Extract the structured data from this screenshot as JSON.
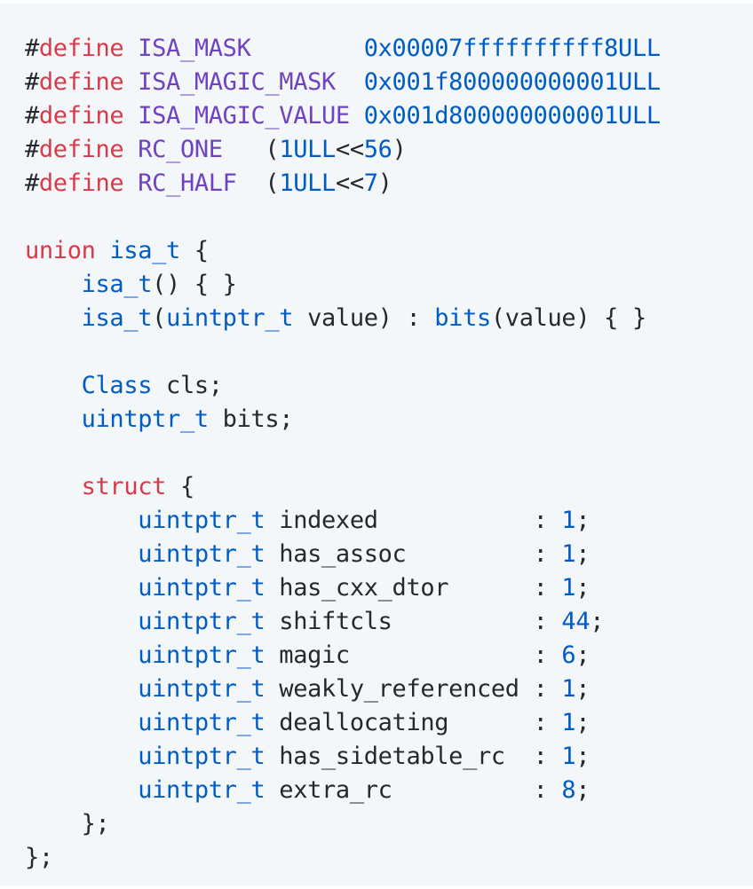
{
  "colors": {
    "background": "#f4f7fa",
    "plain": "#24292e",
    "keyword": "#d73a49",
    "macro": "#6f42c1",
    "type": "#005cc5",
    "number": "#005cc5"
  },
  "code_lines": [
    [
      [
        "plain",
        "#"
      ],
      [
        "keyword",
        "define"
      ],
      [
        "plain",
        " "
      ],
      [
        "macro",
        "ISA_MASK"
      ],
      [
        "plain",
        "        "
      ],
      [
        "number",
        "0x00007ffffffffff8ULL"
      ]
    ],
    [
      [
        "plain",
        "#"
      ],
      [
        "keyword",
        "define"
      ],
      [
        "plain",
        " "
      ],
      [
        "macro",
        "ISA_MAGIC_MASK"
      ],
      [
        "plain",
        "  "
      ],
      [
        "number",
        "0x001f800000000001ULL"
      ]
    ],
    [
      [
        "plain",
        "#"
      ],
      [
        "keyword",
        "define"
      ],
      [
        "plain",
        " "
      ],
      [
        "macro",
        "ISA_MAGIC_VALUE"
      ],
      [
        "plain",
        " "
      ],
      [
        "number",
        "0x001d800000000001ULL"
      ]
    ],
    [
      [
        "plain",
        "#"
      ],
      [
        "keyword",
        "define"
      ],
      [
        "plain",
        " "
      ],
      [
        "macro",
        "RC_ONE"
      ],
      [
        "plain",
        "   ("
      ],
      [
        "number",
        "1ULL"
      ],
      [
        "plain",
        "<<"
      ],
      [
        "number",
        "56"
      ],
      [
        "plain",
        ")"
      ]
    ],
    [
      [
        "plain",
        "#"
      ],
      [
        "keyword",
        "define"
      ],
      [
        "plain",
        " "
      ],
      [
        "macro",
        "RC_HALF"
      ],
      [
        "plain",
        "  ("
      ],
      [
        "number",
        "1ULL"
      ],
      [
        "plain",
        "<<"
      ],
      [
        "number",
        "7"
      ],
      [
        "plain",
        ")"
      ]
    ],
    [],
    [
      [
        "keyword",
        "union"
      ],
      [
        "plain",
        " "
      ],
      [
        "type",
        "isa_t"
      ],
      [
        "plain",
        " {"
      ]
    ],
    [
      [
        "plain",
        "    "
      ],
      [
        "func",
        "isa_t"
      ],
      [
        "plain",
        "() { }"
      ]
    ],
    [
      [
        "plain",
        "    "
      ],
      [
        "func",
        "isa_t"
      ],
      [
        "plain",
        "("
      ],
      [
        "type",
        "uintptr_t"
      ],
      [
        "plain",
        " value) : "
      ],
      [
        "func",
        "bits"
      ],
      [
        "plain",
        "(value) { }"
      ]
    ],
    [],
    [
      [
        "plain",
        "    "
      ],
      [
        "type",
        "Class"
      ],
      [
        "plain",
        " cls;"
      ]
    ],
    [
      [
        "plain",
        "    "
      ],
      [
        "type",
        "uintptr_t"
      ],
      [
        "plain",
        " bits;"
      ]
    ],
    [],
    [
      [
        "plain",
        "    "
      ],
      [
        "keyword",
        "struct"
      ],
      [
        "plain",
        " {"
      ]
    ],
    [
      [
        "plain",
        "        "
      ],
      [
        "type",
        "uintptr_t"
      ],
      [
        "plain",
        " indexed           : "
      ],
      [
        "number",
        "1"
      ],
      [
        "plain",
        ";"
      ]
    ],
    [
      [
        "plain",
        "        "
      ],
      [
        "type",
        "uintptr_t"
      ],
      [
        "plain",
        " has_assoc         : "
      ],
      [
        "number",
        "1"
      ],
      [
        "plain",
        ";"
      ]
    ],
    [
      [
        "plain",
        "        "
      ],
      [
        "type",
        "uintptr_t"
      ],
      [
        "plain",
        " has_cxx_dtor      : "
      ],
      [
        "number",
        "1"
      ],
      [
        "plain",
        ";"
      ]
    ],
    [
      [
        "plain",
        "        "
      ],
      [
        "type",
        "uintptr_t"
      ],
      [
        "plain",
        " shiftcls          : "
      ],
      [
        "number",
        "44"
      ],
      [
        "plain",
        ";"
      ]
    ],
    [
      [
        "plain",
        "        "
      ],
      [
        "type",
        "uintptr_t"
      ],
      [
        "plain",
        " magic             : "
      ],
      [
        "number",
        "6"
      ],
      [
        "plain",
        ";"
      ]
    ],
    [
      [
        "plain",
        "        "
      ],
      [
        "type",
        "uintptr_t"
      ],
      [
        "plain",
        " weakly_referenced : "
      ],
      [
        "number",
        "1"
      ],
      [
        "plain",
        ";"
      ]
    ],
    [
      [
        "plain",
        "        "
      ],
      [
        "type",
        "uintptr_t"
      ],
      [
        "plain",
        " deallocating      : "
      ],
      [
        "number",
        "1"
      ],
      [
        "plain",
        ";"
      ]
    ],
    [
      [
        "plain",
        "        "
      ],
      [
        "type",
        "uintptr_t"
      ],
      [
        "plain",
        " has_sidetable_rc  : "
      ],
      [
        "number",
        "1"
      ],
      [
        "plain",
        ";"
      ]
    ],
    [
      [
        "plain",
        "        "
      ],
      [
        "type",
        "uintptr_t"
      ],
      [
        "plain",
        " extra_rc          : "
      ],
      [
        "number",
        "8"
      ],
      [
        "plain",
        ";"
      ]
    ],
    [
      [
        "plain",
        "    };"
      ]
    ],
    [
      [
        "plain",
        "};"
      ]
    ]
  ]
}
